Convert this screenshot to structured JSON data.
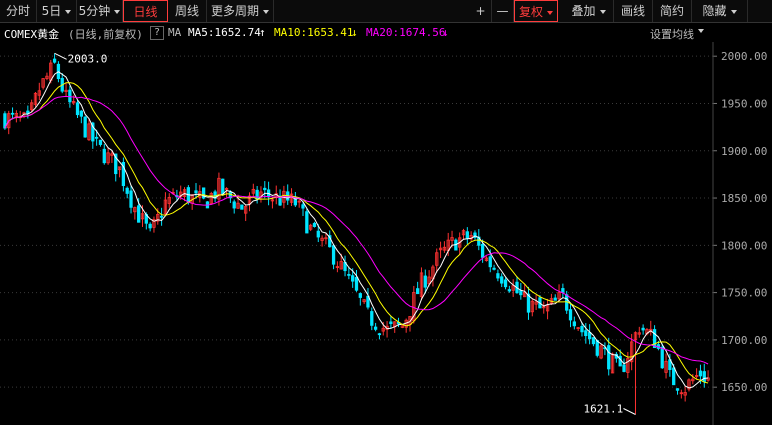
{
  "toolbar": {
    "tabs": [
      {
        "label": "分时",
        "active": false,
        "dropdown": false
      },
      {
        "label": "5日",
        "active": false,
        "dropdown": true
      },
      {
        "label": "5分钟",
        "active": false,
        "dropdown": true
      },
      {
        "label": "日线",
        "active": true,
        "dropdown": false
      },
      {
        "label": "周线",
        "active": false,
        "dropdown": false
      },
      {
        "label": "更多周期",
        "active": false,
        "dropdown": true
      }
    ],
    "right": [
      {
        "label": "+",
        "active": false,
        "dropdown": false
      },
      {
        "label": "—",
        "active": false,
        "dropdown": false
      },
      {
        "label": "复权",
        "active": true,
        "dropdown": true
      },
      {
        "label": "叠加",
        "active": false,
        "dropdown": true
      },
      {
        "label": "画线",
        "active": false,
        "dropdown": false
      },
      {
        "label": "简约",
        "active": false,
        "dropdown": false
      },
      {
        "label": "隐藏",
        "active": false,
        "dropdown": true
      }
    ]
  },
  "infobar": {
    "symbol": "COMEX黄金",
    "period": "(日线,前复权)",
    "help": "?",
    "ma_label": "MA",
    "ma5": "MA5:1652.74",
    "ma5_arrow": "↑",
    "ma10": "MA10:1653.41",
    "ma10_arrow": "↓",
    "ma20": "MA20:1674.56",
    "ma20_arrow": "↓",
    "settings": "设置均线"
  },
  "colors": {
    "up": "#ff3232",
    "down": "#00e5ff",
    "ma5": "#ffffff",
    "ma10": "#ffff00",
    "ma20": "#ff00ff",
    "axis_text": "#aaaaaa",
    "grid": "#3a3a3a",
    "annot": "#ffffff"
  },
  "chart_data": {
    "type": "candlestick",
    "y_ticks": [
      2000.0,
      1950.0,
      1900.0,
      1850.0,
      1800.0,
      1750.0,
      1700.0,
      1650.0
    ],
    "ylim": [
      1610,
      2015
    ],
    "annotations": [
      {
        "label": "2003.0",
        "index": 13,
        "value": 2003.0
      },
      {
        "label": "1621.1",
        "index": 165,
        "value": 1621.1
      }
    ],
    "close_path": [
      [
        0,
        1935
      ],
      [
        6,
        1930
      ],
      [
        9,
        1965
      ],
      [
        13,
        1990
      ],
      [
        16,
        1955
      ],
      [
        20,
        1930
      ],
      [
        24,
        1905
      ],
      [
        30,
        1880
      ],
      [
        34,
        1840
      ],
      [
        38,
        1810
      ],
      [
        42,
        1845
      ],
      [
        46,
        1855
      ],
      [
        52,
        1845
      ],
      [
        56,
        1860
      ],
      [
        62,
        1840
      ],
      [
        67,
        1855
      ],
      [
        71,
        1850
      ],
      [
        76,
        1845
      ],
      [
        81,
        1810
      ],
      [
        86,
        1790
      ],
      [
        91,
        1755
      ],
      [
        95,
        1725
      ],
      [
        100,
        1710
      ],
      [
        104,
        1715
      ],
      [
        109,
        1760
      ],
      [
        114,
        1790
      ],
      [
        118,
        1805
      ],
      [
        122,
        1810
      ],
      [
        126,
        1785
      ],
      [
        131,
        1765
      ],
      [
        136,
        1740
      ],
      [
        141,
        1730
      ],
      [
        146,
        1745
      ],
      [
        151,
        1710
      ],
      [
        156,
        1690
      ],
      [
        161,
        1665
      ],
      [
        166,
        1715
      ],
      [
        170,
        1700
      ],
      [
        174,
        1660
      ],
      [
        178,
        1650
      ],
      [
        182,
        1665
      ],
      [
        185,
        1655
      ]
    ],
    "candle_count": 185
  }
}
